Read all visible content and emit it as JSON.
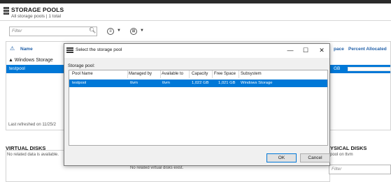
{
  "header": {
    "title": "STORAGE POOLS",
    "subtitle": "All storage pools | 1 total"
  },
  "toolbar": {
    "filter_placeholder": "Filter"
  },
  "pool_list": {
    "columns": {
      "name": "Name",
      "free_space": "pace",
      "percent_allocated": "Percent Allocated"
    },
    "group_label": "Windows Storage",
    "selected_row": {
      "name": "testpool",
      "free": "GB"
    },
    "refreshed_text": "Last refreshed on 11/25/2"
  },
  "virtual_disks": {
    "title": "VIRTUAL DISKS",
    "subtitle": "No related data is available.",
    "empty_text": "No related virtual disks exist."
  },
  "physical_disks": {
    "title": "YSICAL DISKS",
    "subtitle": "pool on ttvm",
    "filter_placeholder": "Filter"
  },
  "dialog": {
    "title": "Select the storage pool",
    "pool_label": "Storage pool:",
    "columns": [
      "Pool Name",
      "Managed by",
      "Available to",
      "Capacity",
      "Free Space",
      "Subsystem"
    ],
    "rows": [
      [
        "testpool",
        "ttvm",
        "ttvm",
        "1,022 GB",
        "1,021 GB",
        "Windows Storage"
      ]
    ],
    "ok_label": "OK",
    "cancel_label": "Cancel",
    "window_buttons": {
      "minimize": "—",
      "maximize": "☐",
      "close": "✕"
    }
  },
  "colors": {
    "selection": "#0078d7",
    "header_link": "#1f5fa8"
  }
}
